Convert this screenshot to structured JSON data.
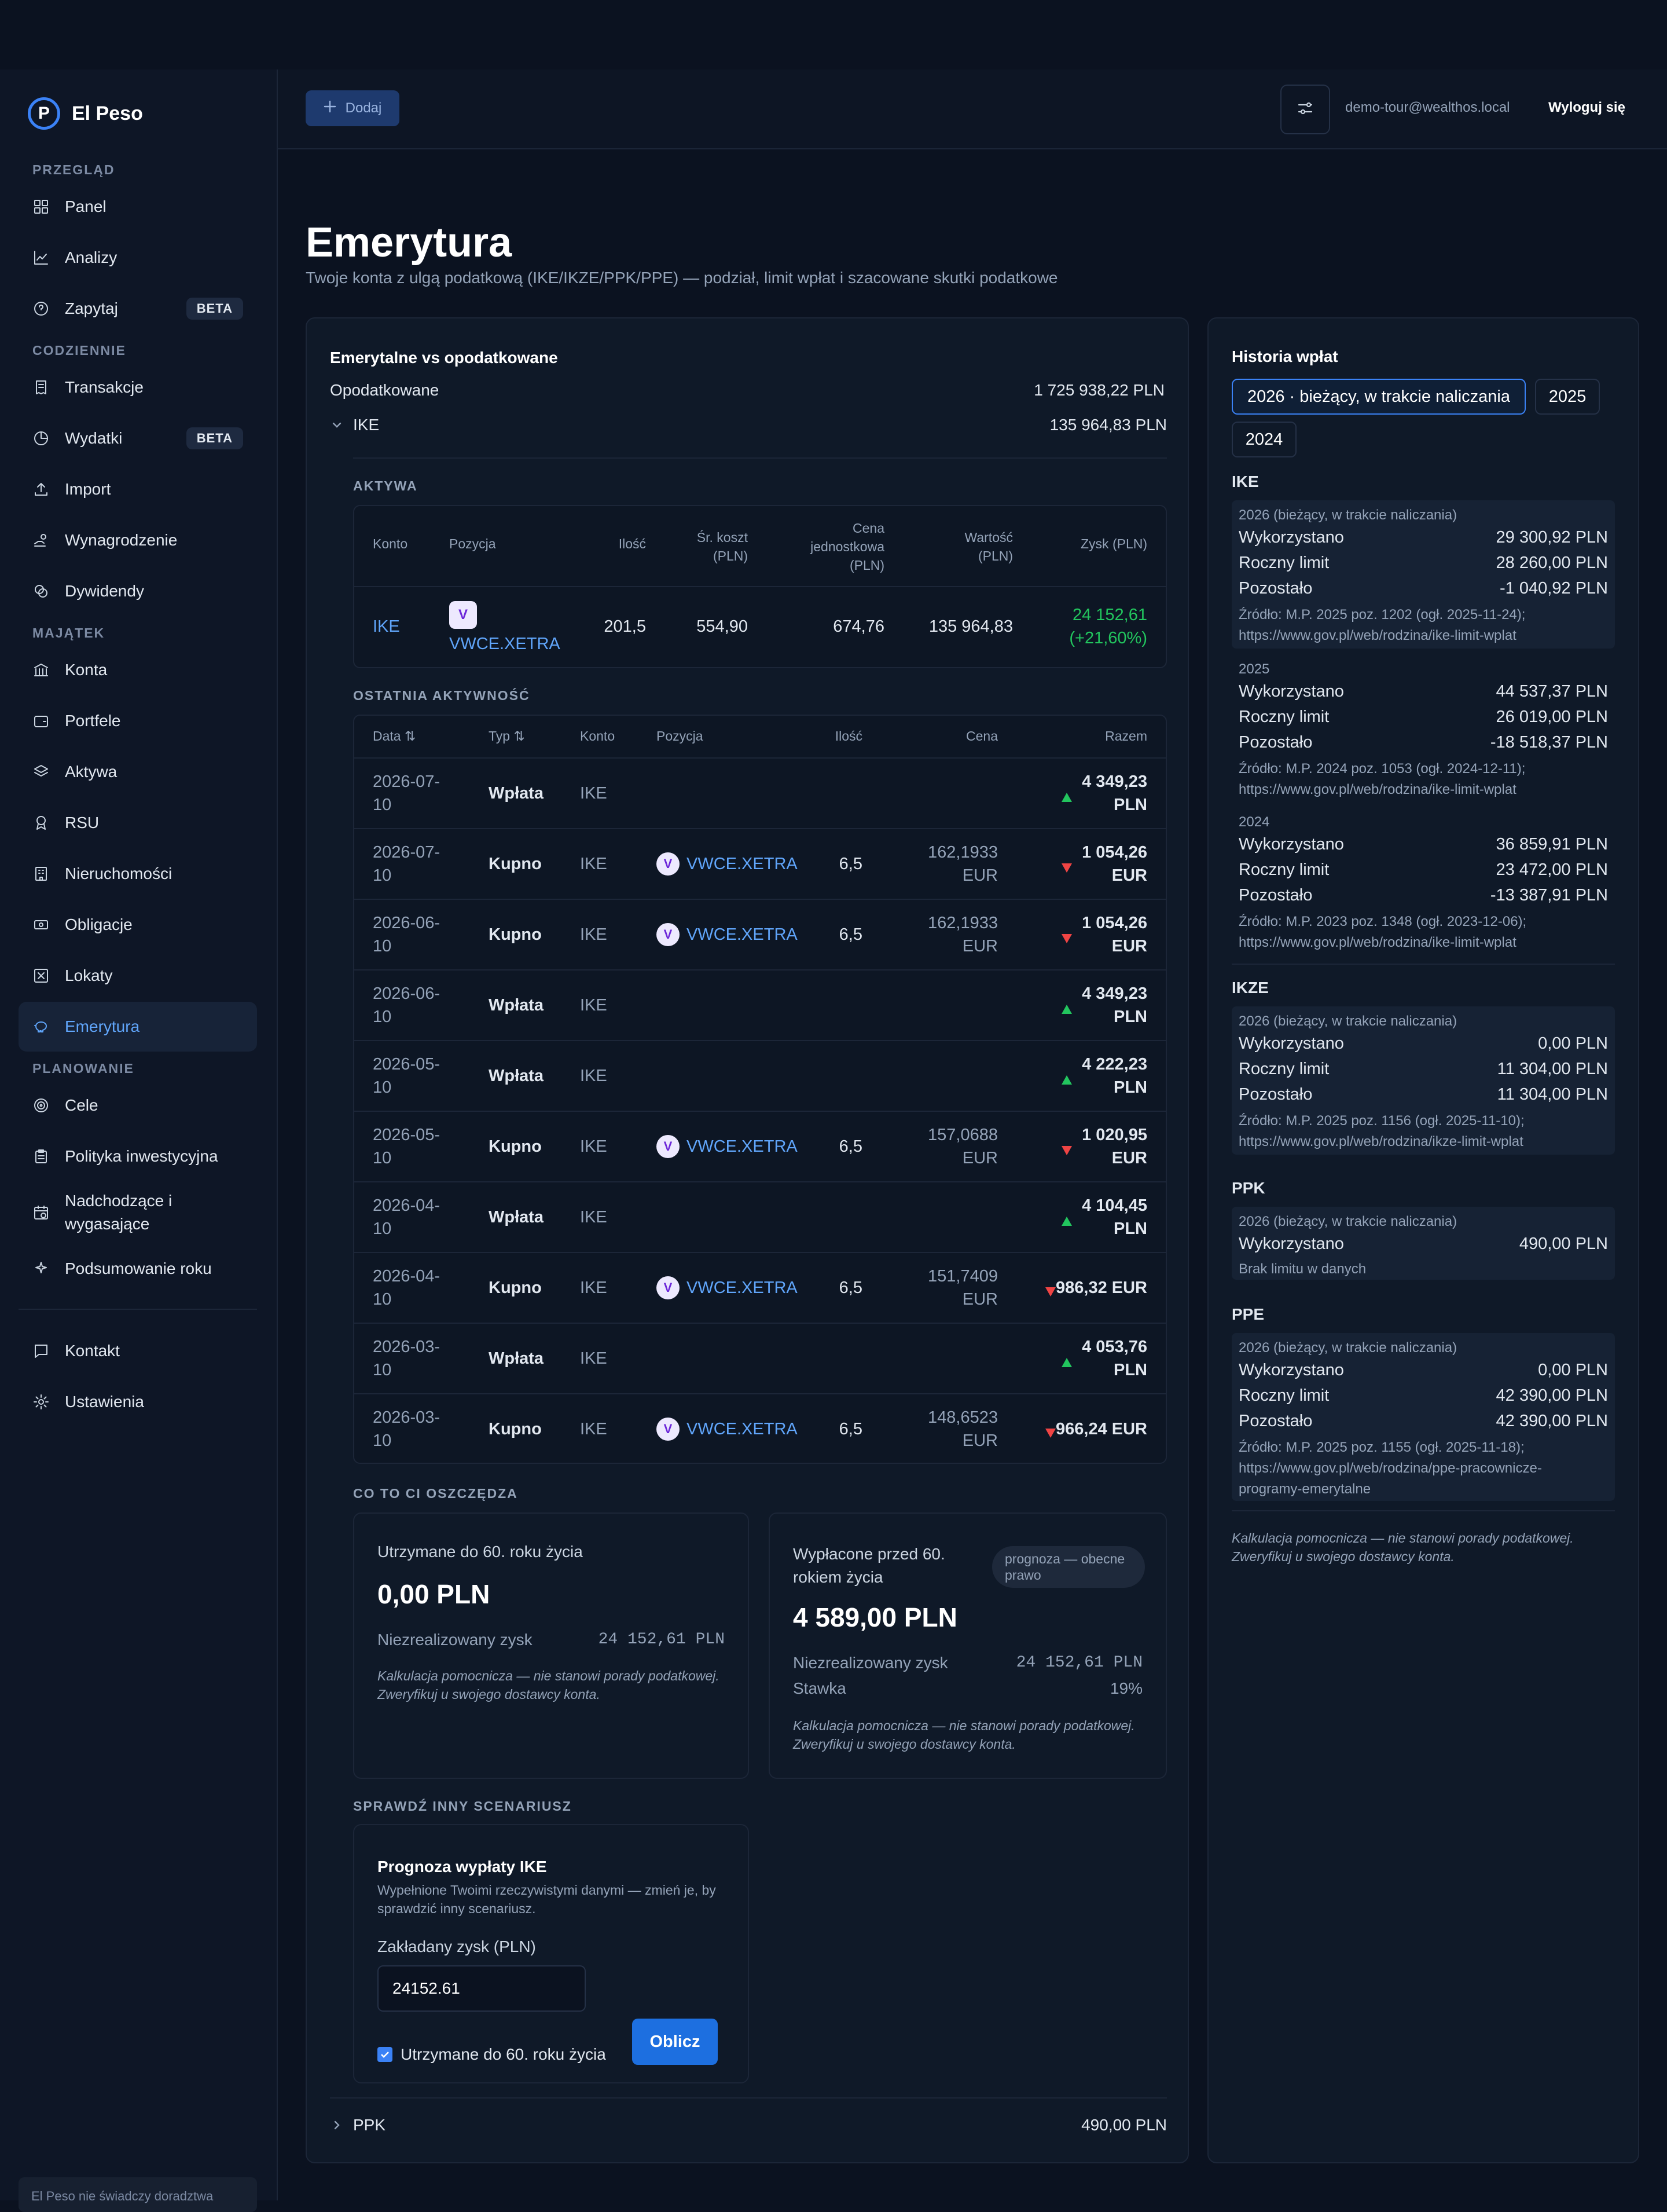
{
  "app": {
    "name": "El Peso",
    "logo_letter": "P"
  },
  "sidebar": {
    "sections": [
      {
        "label": "PRZEGLĄD",
        "items": [
          {
            "label": "Panel",
            "icon": "grid-icon"
          },
          {
            "label": "Analizy",
            "icon": "chart-line-icon"
          },
          {
            "label": "Zapytaj",
            "icon": "chat-question-icon",
            "badge": "BETA"
          }
        ]
      },
      {
        "label": "CODZIENNIE",
        "items": [
          {
            "label": "Transakcje",
            "icon": "receipt-icon"
          },
          {
            "label": "Wydatki",
            "icon": "pie-icon",
            "badge": "BETA"
          },
          {
            "label": "Import",
            "icon": "upload-icon"
          },
          {
            "label": "Wynagrodzenie",
            "icon": "hand-coins-icon"
          },
          {
            "label": "Dywidendy",
            "icon": "coins-icon"
          }
        ]
      },
      {
        "label": "MAJĄTEK",
        "items": [
          {
            "label": "Konta",
            "icon": "bank-icon"
          },
          {
            "label": "Portfele",
            "icon": "wallet-icon"
          },
          {
            "label": "Aktywa",
            "icon": "layers-icon"
          },
          {
            "label": "RSU",
            "icon": "award-icon"
          },
          {
            "label": "Nieruchomości",
            "icon": "building-icon"
          },
          {
            "label": "Obligacje",
            "icon": "banknote-icon"
          },
          {
            "label": "Lokaty",
            "icon": "safe-icon"
          },
          {
            "label": "Emerytura",
            "icon": "piggy-bank-icon",
            "active": true
          }
        ]
      },
      {
        "label": "PLANOWANIE",
        "items": [
          {
            "label": "Cele",
            "icon": "target-icon"
          },
          {
            "label": "Polityka inwestycyjna",
            "icon": "clipboard-icon"
          },
          {
            "label": "Nadchodzące i wygasające",
            "icon": "calendar-clock-icon"
          },
          {
            "label": "Podsumowanie roku",
            "icon": "sparkles-icon"
          }
        ]
      }
    ],
    "footer_items": [
      {
        "label": "Kontakt",
        "icon": "message-icon"
      },
      {
        "label": "Ustawienia",
        "icon": "gear-icon"
      }
    ],
    "disclaimer": "El Peso nie świadczy doradztwa"
  },
  "topbar": {
    "add_label": "Dodaj",
    "user_email": "demo-tour@wealthos.local",
    "logout_label": "Wyloguj się"
  },
  "page": {
    "title": "Emerytura",
    "subtitle": "Twoje konta z ulgą podatkową (IKE/IKZE/PPK/PPE) — podział, limit wpłat i szacowane skutki podatkowe"
  },
  "summary": {
    "heading": "Emerytalne vs opodatkowane",
    "taxed_label": "Opodatkowane",
    "taxed_value": "1 725 938,22 PLN",
    "ike_label": "IKE",
    "ike_value": "135 964,83 PLN",
    "ppk_label": "PPK",
    "ppk_value": "490,00 PLN"
  },
  "assets": {
    "section_label": "AKTYWA",
    "headers": [
      "Konto",
      "Pozycja",
      "Ilość",
      "Śr. koszt (PLN)",
      "Cena jednostkowa (PLN)",
      "Wartość (PLN)",
      "Zysk (PLN)"
    ],
    "row": {
      "account": "IKE",
      "chip": "V",
      "position": "VWCE.XETRA",
      "qty": "201,5",
      "avg_cost": "554,90",
      "unit_price": "674,76",
      "value": "135 964,83",
      "profit": "24 152,61",
      "profit_pct": "(+21,60%)"
    }
  },
  "activity": {
    "section_label": "OSTATNIA AKTYWNOŚĆ",
    "headers": {
      "date": "Data",
      "type": "Typ",
      "account": "Konto",
      "position": "Pozycja",
      "qty": "Ilość",
      "price": "Cena",
      "total": "Razem"
    },
    "rows": [
      {
        "date1": "2026-07-",
        "date2": "10",
        "type": "Wpłata",
        "account": "IKE",
        "position": "",
        "qty": "",
        "price1": "",
        "price2": "",
        "dir": "up",
        "total1": "4 349,23",
        "total2": "PLN"
      },
      {
        "date1": "2026-07-",
        "date2": "10",
        "type": "Kupno",
        "account": "IKE",
        "position": "VWCE.XETRA",
        "qty": "6,5",
        "price1": "162,1933",
        "price2": "EUR",
        "dir": "down",
        "total1": "1 054,26",
        "total2": "EUR"
      },
      {
        "date1": "2026-06-",
        "date2": "10",
        "type": "Kupno",
        "account": "IKE",
        "position": "VWCE.XETRA",
        "qty": "6,5",
        "price1": "162,1933",
        "price2": "EUR",
        "dir": "down",
        "total1": "1 054,26",
        "total2": "EUR"
      },
      {
        "date1": "2026-06-",
        "date2": "10",
        "type": "Wpłata",
        "account": "IKE",
        "position": "",
        "qty": "",
        "price1": "",
        "price2": "",
        "dir": "up",
        "total1": "4 349,23",
        "total2": "PLN"
      },
      {
        "date1": "2026-05-",
        "date2": "10",
        "type": "Wpłata",
        "account": "IKE",
        "position": "",
        "qty": "",
        "price1": "",
        "price2": "",
        "dir": "up",
        "total1": "4 222,23",
        "total2": "PLN"
      },
      {
        "date1": "2026-05-",
        "date2": "10",
        "type": "Kupno",
        "account": "IKE",
        "position": "VWCE.XETRA",
        "qty": "6,5",
        "price1": "157,0688",
        "price2": "EUR",
        "dir": "down",
        "total1": "1 020,95",
        "total2": "EUR"
      },
      {
        "date1": "2026-04-",
        "date2": "10",
        "type": "Wpłata",
        "account": "IKE",
        "position": "",
        "qty": "",
        "price1": "",
        "price2": "",
        "dir": "up",
        "total1": "4 104,45",
        "total2": "PLN"
      },
      {
        "date1": "2026-04-",
        "date2": "10",
        "type": "Kupno",
        "account": "IKE",
        "position": "VWCE.XETRA",
        "qty": "6,5",
        "price1": "151,7409",
        "price2": "EUR",
        "dir": "down",
        "total1": "986,32 EUR",
        "total2": ""
      },
      {
        "date1": "2026-03-",
        "date2": "10",
        "type": "Wpłata",
        "account": "IKE",
        "position": "",
        "qty": "",
        "price1": "",
        "price2": "",
        "dir": "up",
        "total1": "4 053,76",
        "total2": "PLN"
      },
      {
        "date1": "2026-03-",
        "date2": "10",
        "type": "Kupno",
        "account": "IKE",
        "position": "VWCE.XETRA",
        "qty": "6,5",
        "price1": "148,6523",
        "price2": "EUR",
        "dir": "down",
        "total1": "966,24 EUR",
        "total2": ""
      }
    ]
  },
  "savings": {
    "section_label": "CO TO CI OSZCZĘDZA",
    "kept": {
      "title": "Utrzymane do 60. roku życia",
      "amount": "0,00 PLN",
      "gain_label": "Niezrealizowany zysk",
      "gain_value": "24 152,61 PLN",
      "note": "Kalkulacja pomocnicza — nie stanowi porady podatkowej. Zweryfikuj u swojego dostawcy konta."
    },
    "early": {
      "title": "Wypłacone przed 60. rokiem życia",
      "badge": "prognoza — obecne prawo",
      "amount": "4 589,00 PLN",
      "gain_label": "Niezrealizowany zysk",
      "gain_value": "24 152,61 PLN",
      "rate_label": "Stawka",
      "rate_value": "19%",
      "note": "Kalkulacja pomocnicza — nie stanowi porady podatkowej. Zweryfikuj u swojego dostawcy konta."
    }
  },
  "scenario": {
    "section_label": "SPRAWDŹ INNY SCENARIUSZ",
    "title": "Prognoza wypłaty IKE",
    "desc": "Wypełnione Twoimi rzeczywistymi danymi — zmień je, by sprawdzić inny scenariusz.",
    "field_label": "Zakładany zysk (PLN)",
    "field_value": "24152.61",
    "checkbox_label": "Utrzymane do 60. roku życia",
    "button": "Oblicz"
  },
  "history": {
    "heading": "Historia wpłat",
    "years": [
      "2026 · bieżący, w trakcie naliczania",
      "2025",
      "2024"
    ],
    "ike": {
      "label": "IKE",
      "blocks": [
        {
          "caption": "2026 (bieżący, w trakcie naliczania)",
          "used_label": "Wykorzystano",
          "used": "29 300,92 PLN",
          "limit_label": "Roczny limit",
          "limit": "28 260,00 PLN",
          "left_label": "Pozostało",
          "left": "-1 040,92 PLN",
          "src1": "Źródło: M.P. 2025 poz. 1202 (ogł. 2025-11-24);",
          "src2": "https://www.gov.pl/web/rodzina/ike-limit-wplat"
        },
        {
          "caption": "2025",
          "used_label": "Wykorzystano",
          "used": "44 537,37 PLN",
          "limit_label": "Roczny limit",
          "limit": "26 019,00 PLN",
          "left_label": "Pozostało",
          "left": "-18 518,37 PLN",
          "src1": "Źródło: M.P. 2024 poz. 1053 (ogł. 2024-12-11);",
          "src2": "https://www.gov.pl/web/rodzina/ike-limit-wplat"
        },
        {
          "caption": "2024",
          "used_label": "Wykorzystano",
          "used": "36 859,91 PLN",
          "limit_label": "Roczny limit",
          "limit": "23 472,00 PLN",
          "left_label": "Pozostało",
          "left": "-13 387,91 PLN",
          "src1": "Źródło: M.P. 2023 poz. 1348 (ogł. 2023-12-06);",
          "src2": "https://www.gov.pl/web/rodzina/ike-limit-wplat"
        }
      ]
    },
    "ikze": {
      "label": "IKZE",
      "caption": "2026 (bieżący, w trakcie naliczania)",
      "used_label": "Wykorzystano",
      "used": "0,00 PLN",
      "limit_label": "Roczny limit",
      "limit": "11 304,00 PLN",
      "left_label": "Pozostało",
      "left": "11 304,00 PLN",
      "src1": "Źródło: M.P. 2025 poz. 1156 (ogł. 2025-11-10);",
      "src2": "https://www.gov.pl/web/rodzina/ikze-limit-wplat"
    },
    "ppk": {
      "label": "PPK",
      "caption": "2026 (bieżący, w trakcie naliczania)",
      "used_label": "Wykorzystano",
      "used": "490,00 PLN",
      "note": "Brak limitu w danych"
    },
    "ppe": {
      "label": "PPE",
      "caption": "2026 (bieżący, w trakcie naliczania)",
      "used_label": "Wykorzystano",
      "used": "0,00 PLN",
      "limit_label": "Roczny limit",
      "limit": "42 390,00 PLN",
      "left_label": "Pozostało",
      "left": "42 390,00 PLN",
      "src1": "Źródło: M.P. 2025 poz. 1155 (ogł. 2025-11-18);",
      "src2": "https://www.gov.pl/web/rodzina/ppe-pracownicze-",
      "src3": "programy-emerytalne"
    },
    "footer": "Kalkulacja pomocnicza — nie stanowi porady podatkowej. Zweryfikuj u swojego dostawcy konta."
  },
  "colors": {
    "accent": "#3b82f6",
    "positive": "#22c55e",
    "negative": "#ef4444",
    "bg": "#0b1220"
  }
}
